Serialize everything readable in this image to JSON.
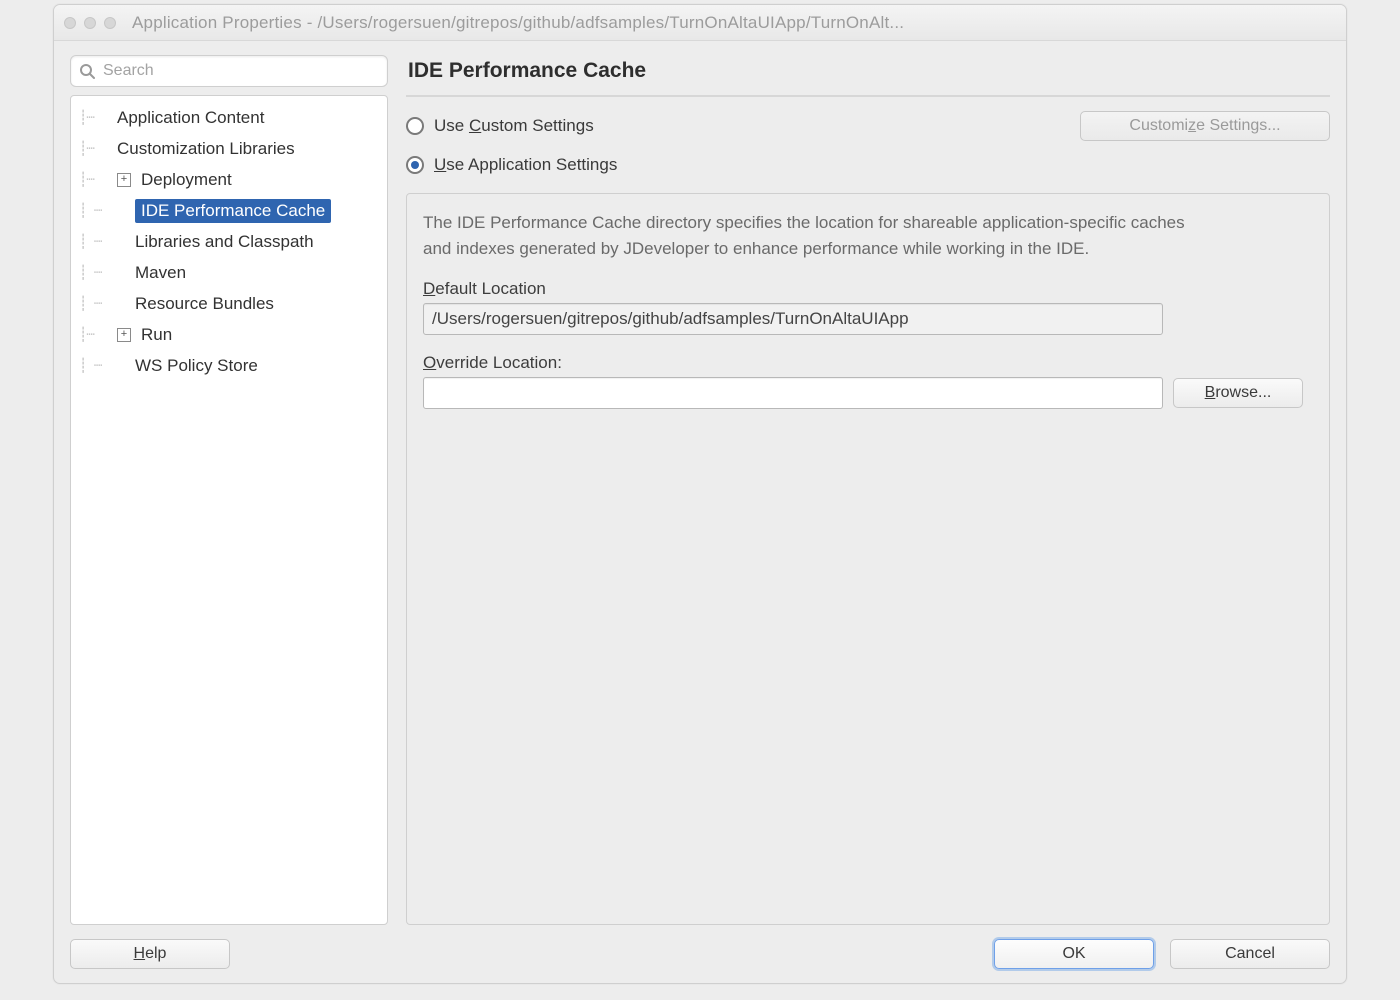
{
  "window": {
    "title": "Application Properties - /Users/rogersuen/gitrepos/github/adfsamples/TurnOnAltaUIApp/TurnOnAlt..."
  },
  "sidebar": {
    "search_placeholder": "Search",
    "items": [
      {
        "label": "Application Content",
        "expandable": false,
        "indent": 0
      },
      {
        "label": "Customization Libraries",
        "expandable": false,
        "indent": 0
      },
      {
        "label": "Deployment",
        "expandable": true,
        "expanded": false,
        "indent": 0
      },
      {
        "label": "IDE Performance Cache",
        "expandable": false,
        "indent": 1,
        "selected": true
      },
      {
        "label": "Libraries and Classpath",
        "expandable": false,
        "indent": 1
      },
      {
        "label": "Maven",
        "expandable": false,
        "indent": 1
      },
      {
        "label": "Resource Bundles",
        "expandable": false,
        "indent": 1
      },
      {
        "label": "Run",
        "expandable": true,
        "expanded": false,
        "indent": 0
      },
      {
        "label": "WS Policy Store",
        "expandable": false,
        "indent": 1
      }
    ]
  },
  "content": {
    "heading": "IDE Performance Cache",
    "radio_custom": "Use Custom Settings",
    "radio_app": "Use Application Settings",
    "radio_selected": "app",
    "customize_btn": "Customize Settings...",
    "description": "The IDE Performance Cache directory specifies the location for shareable application-specific caches and indexes generated by JDeveloper to enhance performance while working in the IDE.",
    "default_label": "Default Location",
    "default_value": "/Users/rogersuen/gitrepos/github/adfsamples/TurnOnAltaUIApp",
    "override_label": "Override Location:",
    "override_value": "",
    "browse_btn": "Browse..."
  },
  "footer": {
    "help": "Help",
    "ok": "OK",
    "cancel": "Cancel"
  }
}
